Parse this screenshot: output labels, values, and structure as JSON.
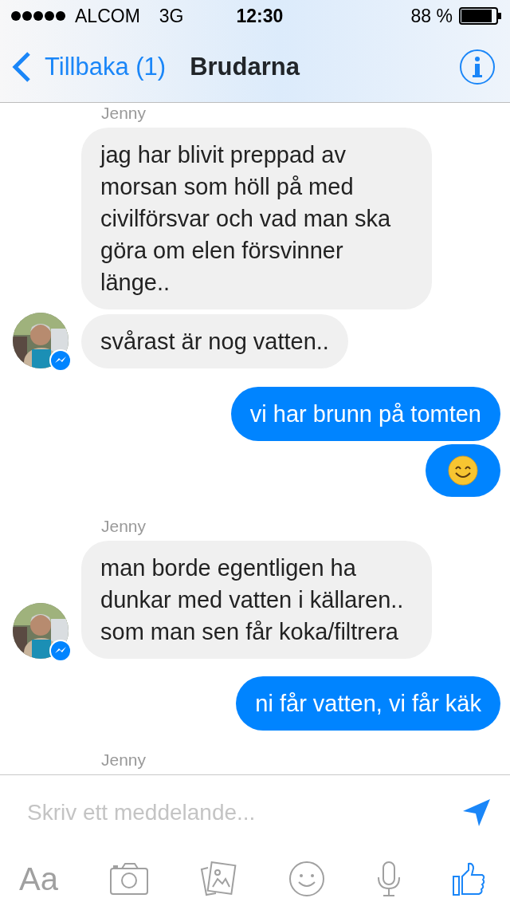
{
  "status_bar": {
    "carrier": "ALCOM",
    "network": "3G",
    "time": "12:30",
    "battery": "88 %"
  },
  "nav": {
    "back": "Tillbaka (1)",
    "title": "Brudarna"
  },
  "groups": [
    {
      "kind": "incoming",
      "sender": "Jenny",
      "messages": [
        {
          "kind": "text",
          "text": "jag har blivit preppad av morsan som höll på med civilförsvar och vad man ska göra om elen försvinner länge.."
        },
        {
          "kind": "text",
          "text": "svårast är nog vatten.."
        }
      ]
    },
    {
      "kind": "outgoing",
      "messages": [
        {
          "kind": "text",
          "text": "vi har brunn på tomten"
        },
        {
          "kind": "emoji"
        }
      ]
    },
    {
      "kind": "incoming",
      "sender": "Jenny",
      "messages": [
        {
          "kind": "text",
          "text": "man borde egentligen ha dunkar med vatten i källaren.. som man sen får koka/filtrera"
        }
      ]
    },
    {
      "kind": "outgoing",
      "messages": [
        {
          "kind": "text",
          "text": "ni får vatten, vi får käk"
        }
      ]
    },
    {
      "kind": "incoming",
      "sender": "Jenny"
    }
  ],
  "composer": {
    "placeholder": "Skriv ett meddelande...",
    "font_button": "Aa"
  }
}
